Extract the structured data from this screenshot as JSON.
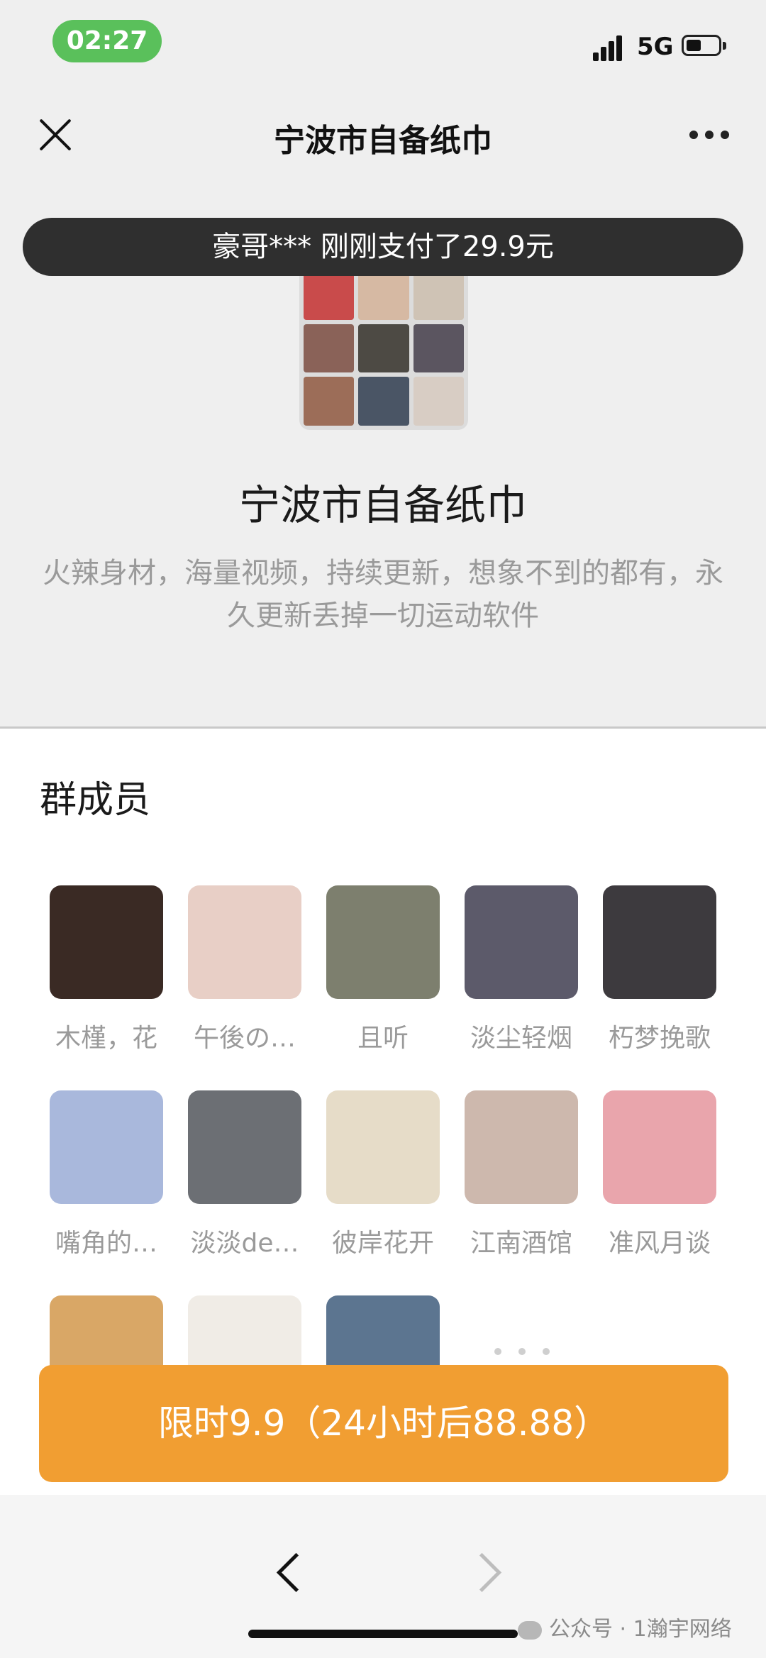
{
  "status_bar": {
    "time": "02:27",
    "network": "5G"
  },
  "nav": {
    "title": "宁波市自备纸巾"
  },
  "toast": {
    "text": "豪哥*** 刚刚支付了29.9元"
  },
  "group": {
    "name": "宁波市自备纸巾",
    "description_line1": "火辣身材，海量视频，持续更新，想象不到的都有，永",
    "description_line2": "久更新丢掉一切运动软件"
  },
  "members": {
    "title": "群成员",
    "items": [
      {
        "name": "木槿，花",
        "color": "#3a2a24"
      },
      {
        "name": "午後の…",
        "color": "#e8cfc6"
      },
      {
        "name": "且听",
        "color": "#7d7f6e"
      },
      {
        "name": "淡尘轻烟",
        "color": "#5c5a6a"
      },
      {
        "name": "朽梦挽歌",
        "color": "#3d3a3e"
      },
      {
        "name": "嘴角的…",
        "color": "#a9b8dc"
      },
      {
        "name": "淡淡de…",
        "color": "#6c6f74"
      },
      {
        "name": "彼岸花开",
        "color": "#e6dcc8"
      },
      {
        "name": "江南酒馆",
        "color": "#cdb8ad"
      },
      {
        "name": "准风月谈",
        "color": "#e9a5ac"
      },
      {
        "name": "",
        "color": "#d9a766"
      },
      {
        "name": "",
        "color": "#f0ece6"
      },
      {
        "name": "",
        "color": "#5c7590"
      }
    ]
  },
  "group_avatar_colors": [
    "#c94b4b",
    "#d6b9a3",
    "#cfc3b5",
    "#8a6258",
    "#4d4a44",
    "#5b5560",
    "#9c6d58",
    "#4a5565",
    "#d8cdc4"
  ],
  "cta": {
    "label": "限时9.9（24小时后88.88）"
  },
  "footer": {
    "watermark": "公众号 · 1瀚宇网络"
  }
}
